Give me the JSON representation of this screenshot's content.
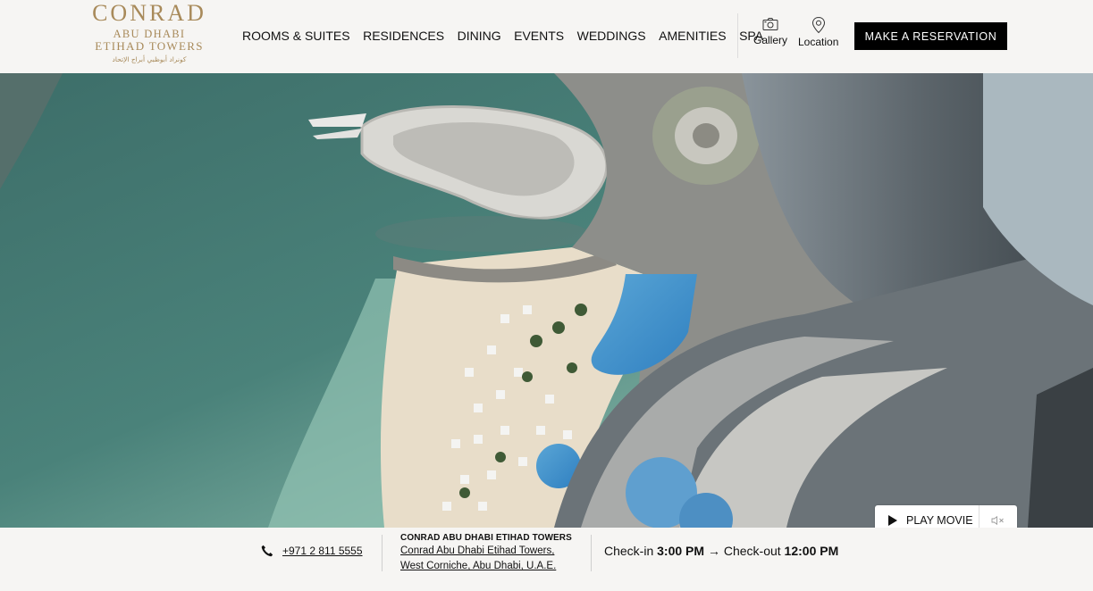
{
  "brand": {
    "logo_main": "CONRAD",
    "logo_line1": "ABU DHABI",
    "logo_line2": "ETIHAD TOWERS",
    "logo_arabic": "كونراد أبوظبي أبراج الإتحاد",
    "gold_color": "#a88a5a"
  },
  "nav": {
    "items": [
      "ROOMS & SUITES",
      "RESIDENCES",
      "DINING",
      "EVENTS",
      "WEDDINGS",
      "AMENITIES",
      "SPA"
    ]
  },
  "tools": {
    "gallery_label": "Gallery",
    "gallery_icon": "camera-icon",
    "location_label": "Location",
    "location_icon": "map-pin-icon"
  },
  "reserve_label": "MAKE A RESERVATION",
  "hero": {
    "play_label": "PLAY MOVIE",
    "play_icon": "play-icon",
    "mute_icon": "mute-icon"
  },
  "footer": {
    "phone_icon": "phone-icon",
    "phone": "+971 2 811 5555",
    "hotel_name": "CONRAD ABU DHABI ETIHAD TOWERS",
    "address_line1": "Conrad Abu Dhabi Etihad Towers,",
    "address_line2": "West Corniche, Abu Dhabi, U.A.E.",
    "checkin_label": "Check-in",
    "checkin_time": "3:00 PM",
    "arrow": "→",
    "checkout_label": "Check-out",
    "checkout_time": "12:00 PM"
  }
}
